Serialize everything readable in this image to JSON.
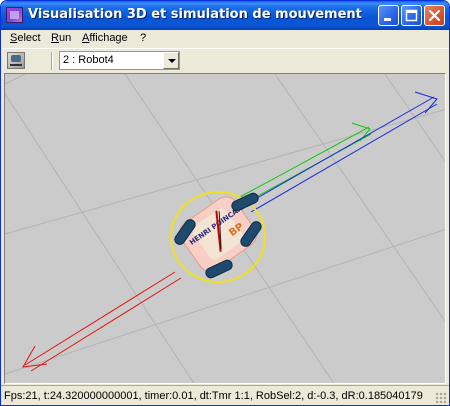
{
  "window": {
    "title": "Visualisation 3D et simulation de mouvement"
  },
  "menu": {
    "items": [
      "Select",
      "Run",
      "Affichage",
      "?"
    ]
  },
  "toolbar": {
    "robot_selector_value": "2 : Robot4"
  },
  "scene": {
    "robot_label": "HENRI POINCARE"
  },
  "status": {
    "text": "Fps:21, t:24.320000000001, timer:0.01, dt:Tmr 1:1, RobSel:2, d:-0.3, dR:0.185040179"
  }
}
